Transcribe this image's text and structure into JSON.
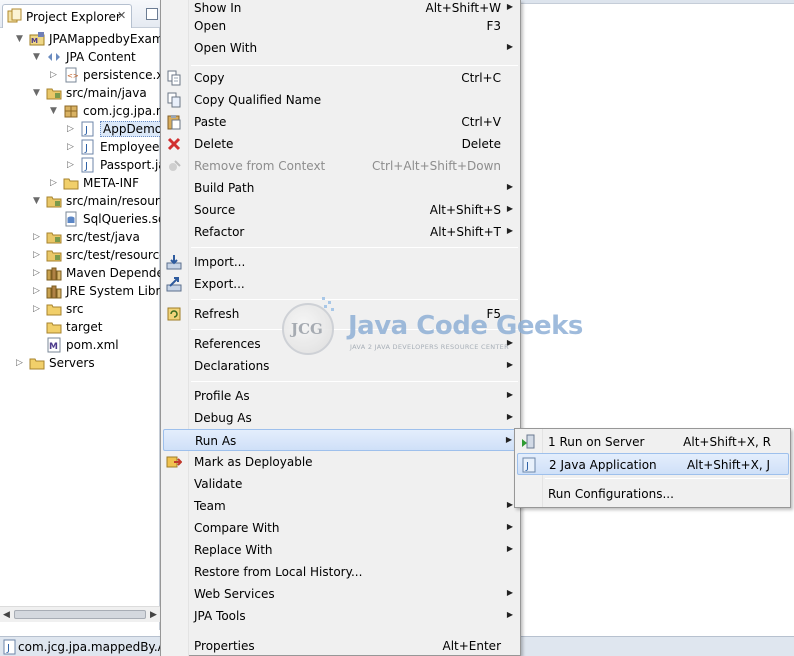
{
  "explorer": {
    "tab_label": "Project Explorer",
    "tab_close": "✕",
    "tree": [
      {
        "label": "JPAMappedbyExample",
        "icon": "maven-project-icon",
        "twisty": "▼"
      },
      {
        "label": "JPA Content",
        "icon": "jpa-content-icon",
        "twisty": "▼"
      },
      {
        "label": "persistence.xml",
        "icon": "xml-file-icon",
        "twisty": "▷"
      },
      {
        "label": "src/main/java",
        "icon": "source-folder-icon",
        "twisty": "▼"
      },
      {
        "label": "com.jcg.jpa.mappedBy",
        "icon": "package-icon",
        "twisty": "▼"
      },
      {
        "label": "AppDemo.java",
        "icon": "java-file-icon",
        "twisty": "▷"
      },
      {
        "label": "Employee.java",
        "icon": "java-file-icon",
        "twisty": "▷"
      },
      {
        "label": "Passport.java",
        "icon": "java-file-icon",
        "twisty": "▷"
      },
      {
        "label": "META-INF",
        "icon": "folder-icon",
        "twisty": "▷"
      },
      {
        "label": "src/main/resources",
        "icon": "source-folder-icon",
        "twisty": "▼"
      },
      {
        "label": "SqlQueries.sql",
        "icon": "sql-file-icon",
        "twisty": ""
      },
      {
        "label": "src/test/java",
        "icon": "source-folder-icon",
        "twisty": "▷"
      },
      {
        "label": "src/test/resources",
        "icon": "source-folder-icon",
        "twisty": "▷"
      },
      {
        "label": "Maven Dependencies",
        "icon": "library-icon",
        "twisty": "▷"
      },
      {
        "label": "JRE System Library",
        "icon": "library-icon",
        "twisty": "▷"
      },
      {
        "label": "src",
        "icon": "folder-icon",
        "twisty": "▷"
      },
      {
        "label": "target",
        "icon": "folder-icon",
        "twisty": ""
      },
      {
        "label": "pom.xml",
        "icon": "maven-pom-icon",
        "twisty": ""
      },
      {
        "label": "Servers",
        "icon": "folder-icon",
        "twisty": "▷"
      }
    ],
    "scroll_left": "◀",
    "scroll_right": "▶"
  },
  "status": {
    "text": "com.jcg.jpa.mappedBy.AppDemo.java - JPAMappedbyExample/src/main/java"
  },
  "context_menu": {
    "submenu_arrow": "▶",
    "items": [
      {
        "label": "Show In",
        "shortcut": "Alt+Shift+W",
        "submenu": true,
        "icon": ""
      },
      {
        "label": "Open",
        "shortcut": "F3",
        "submenu": false,
        "icon": ""
      },
      {
        "label": "Open With",
        "shortcut": "",
        "submenu": true,
        "icon": ""
      },
      {
        "label": "Copy",
        "shortcut": "Ctrl+C",
        "submenu": false,
        "icon": "copy-icon"
      },
      {
        "label": "Copy Qualified Name",
        "shortcut": "",
        "submenu": false,
        "icon": "copy-qualified-name-icon"
      },
      {
        "label": "Paste",
        "shortcut": "Ctrl+V",
        "submenu": false,
        "icon": "paste-icon"
      },
      {
        "label": "Delete",
        "shortcut": "Delete",
        "submenu": false,
        "icon": "delete-icon"
      },
      {
        "label": "Remove from Context",
        "shortcut": "Ctrl+Alt+Shift+Down",
        "submenu": false,
        "icon": "remove-context-icon",
        "disabled": true
      },
      {
        "label": "Build Path",
        "shortcut": "",
        "submenu": true,
        "icon": ""
      },
      {
        "label": "Source",
        "shortcut": "Alt+Shift+S",
        "submenu": true,
        "icon": ""
      },
      {
        "label": "Refactor",
        "shortcut": "Alt+Shift+T",
        "submenu": true,
        "icon": ""
      },
      {
        "label": "Import...",
        "shortcut": "",
        "submenu": false,
        "icon": "import-icon"
      },
      {
        "label": "Export...",
        "shortcut": "",
        "submenu": false,
        "icon": "export-icon"
      },
      {
        "label": "Refresh",
        "shortcut": "F5",
        "submenu": false,
        "icon": "refresh-icon"
      },
      {
        "label": "References",
        "shortcut": "",
        "submenu": true,
        "icon": ""
      },
      {
        "label": "Declarations",
        "shortcut": "",
        "submenu": true,
        "icon": ""
      },
      {
        "label": "Profile As",
        "shortcut": "",
        "submenu": true,
        "icon": ""
      },
      {
        "label": "Debug As",
        "shortcut": "",
        "submenu": true,
        "icon": ""
      },
      {
        "label": "Run As",
        "shortcut": "",
        "submenu": true,
        "icon": "",
        "highlighted": true
      },
      {
        "label": "Mark as Deployable",
        "shortcut": "",
        "submenu": false,
        "icon": "mark-deployable-icon"
      },
      {
        "label": "Validate",
        "shortcut": "",
        "submenu": false,
        "icon": ""
      },
      {
        "label": "Team",
        "shortcut": "",
        "submenu": true,
        "icon": ""
      },
      {
        "label": "Compare With",
        "shortcut": "",
        "submenu": true,
        "icon": ""
      },
      {
        "label": "Replace With",
        "shortcut": "",
        "submenu": true,
        "icon": ""
      },
      {
        "label": "Restore from Local History...",
        "shortcut": "",
        "submenu": false,
        "icon": ""
      },
      {
        "label": "Web Services",
        "shortcut": "",
        "submenu": true,
        "icon": ""
      },
      {
        "label": "JPA Tools",
        "shortcut": "",
        "submenu": true,
        "icon": ""
      },
      {
        "label": "Properties",
        "shortcut": "Alt+Enter",
        "submenu": false,
        "icon": ""
      }
    ]
  },
  "run_as_submenu": {
    "items": [
      {
        "label": "1 Run on Server",
        "shortcut": "Alt+Shift+X, R",
        "icon": "run-on-server-icon"
      },
      {
        "label": "2 Java Application",
        "shortcut": "Alt+Shift+X, J",
        "icon": "java-application-icon",
        "highlighted": true
      },
      {
        "label": "Run Configurations...",
        "shortcut": "",
        "icon": ""
      }
    ]
  },
  "watermark": {
    "logo_letters": "JCG",
    "title": "Java Code Geeks",
    "subtitle": "JAVA 2 JAVA DEVELOPERS RESOURCE CENTER"
  },
  "colors": {
    "highlight": "#cfe0f8",
    "menu_bg": "#f0f0f0",
    "selection": "#dbe8f8",
    "watermark_blue": "#8fb0d6"
  }
}
